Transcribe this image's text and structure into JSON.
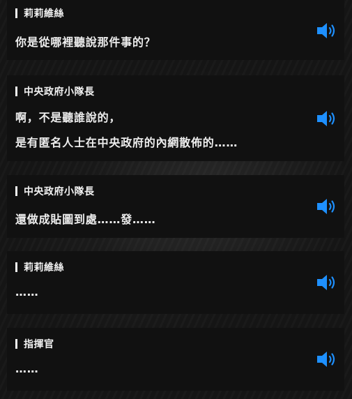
{
  "ui": {
    "accent_color": "#1e90ff"
  },
  "dialogues": [
    {
      "speaker": "莉莉維絲",
      "lines": [
        "你是從哪裡聽說那件事的？"
      ],
      "voice_icon": "speaker-sound-icon"
    },
    {
      "speaker": "中央政府小隊長",
      "lines": [
        "啊，不是聽誰說的，",
        "是有匿名人士在中央政府的內網散佈的……"
      ],
      "voice_icon": "speaker-sound-icon"
    },
    {
      "speaker": "中央政府小隊長",
      "lines": [
        "還做成貼圖到處……發……"
      ],
      "voice_icon": "speaker-sound-icon"
    },
    {
      "speaker": "莉莉維絲",
      "lines": [
        "……"
      ],
      "voice_icon": "speaker-sound-icon"
    },
    {
      "speaker": "指揮官",
      "lines": [
        "……"
      ],
      "voice_icon": "speaker-sound-icon"
    }
  ]
}
